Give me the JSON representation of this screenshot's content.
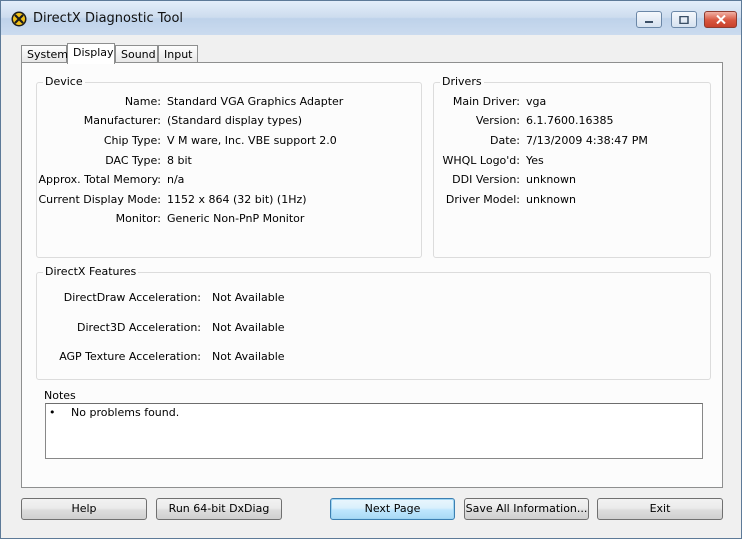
{
  "window": {
    "title": "DirectX Diagnostic Tool",
    "icon": "directx-x-icon"
  },
  "tabs": [
    {
      "label": "System"
    },
    {
      "label": "Display",
      "active": true
    },
    {
      "label": "Sound"
    },
    {
      "label": "Input"
    }
  ],
  "device": {
    "title": "Device",
    "rows": [
      {
        "label": "Name:",
        "value": "Standard VGA Graphics Adapter"
      },
      {
        "label": "Manufacturer:",
        "value": "(Standard display types)"
      },
      {
        "label": "Chip Type:",
        "value": "V M ware, Inc. VBE support 2.0"
      },
      {
        "label": "DAC Type:",
        "value": "8 bit"
      },
      {
        "label": "Approx. Total Memory:",
        "value": "n/a"
      },
      {
        "label": "Current Display Mode:",
        "value": "1152 x 864 (32 bit) (1Hz)"
      },
      {
        "label": "Monitor:",
        "value": "Generic Non-PnP Monitor"
      }
    ]
  },
  "drivers": {
    "title": "Drivers",
    "rows": [
      {
        "label": "Main Driver:",
        "value": "vga"
      },
      {
        "label": "Version:",
        "value": "6.1.7600.16385"
      },
      {
        "label": "Date:",
        "value": "7/13/2009 4:38:47 PM"
      },
      {
        "label": "WHQL Logo'd:",
        "value": "Yes"
      },
      {
        "label": "DDI Version:",
        "value": "unknown"
      },
      {
        "label": "Driver Model:",
        "value": "unknown"
      }
    ]
  },
  "features": {
    "title": "DirectX Features",
    "rows": [
      {
        "label": "DirectDraw Acceleration:",
        "value": "Not Available"
      },
      {
        "label": "Direct3D Acceleration:",
        "value": "Not Available"
      },
      {
        "label": "AGP Texture Acceleration:",
        "value": "Not Available"
      }
    ]
  },
  "notes": {
    "title": "Notes",
    "bullet": "•",
    "items": [
      "No problems found."
    ]
  },
  "buttons": {
    "help": "Help",
    "run64": "Run 64-bit DxDiag",
    "next": "Next Page",
    "save": "Save All Information...",
    "exit": "Exit"
  }
}
